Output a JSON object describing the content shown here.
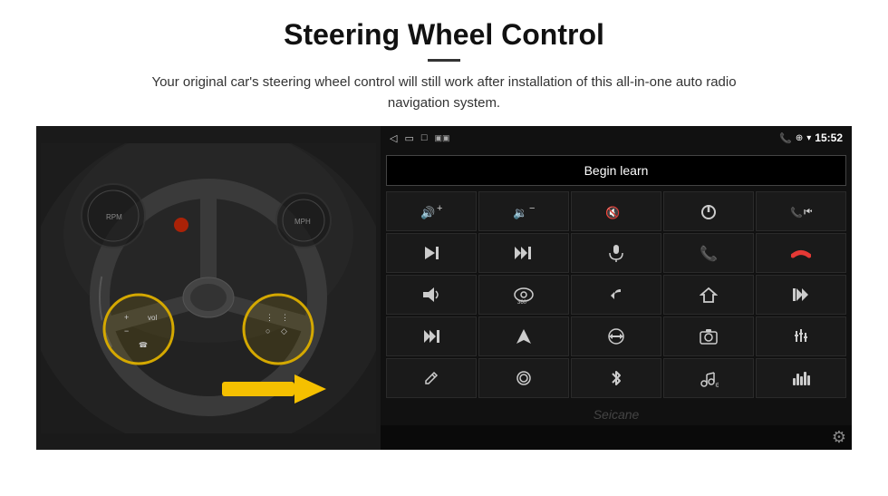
{
  "header": {
    "title": "Steering Wheel Control",
    "divider": true,
    "subtitle": "Your original car's steering wheel control will still work after installation of this all-in-one auto radio navigation system."
  },
  "statusbar": {
    "back_icon": "◁",
    "window_icon": "▭",
    "square_icon": "□",
    "signal_icon": "▣▣",
    "phone_icon": "📞",
    "location_icon": "⊕",
    "wifi_icon": "▾",
    "time": "15:52"
  },
  "begin_learn": {
    "label": "Begin learn"
  },
  "watermark": {
    "text": "Seicane"
  },
  "controls": [
    {
      "icon": "🔊+",
      "name": "vol-up"
    },
    {
      "icon": "🔊−",
      "name": "vol-down"
    },
    {
      "icon": "🔇",
      "name": "mute"
    },
    {
      "icon": "⏻",
      "name": "power"
    },
    {
      "icon": "⏮",
      "name": "prev-track-r"
    },
    {
      "icon": "⏭",
      "name": "next-track"
    },
    {
      "icon": "⤓⏭",
      "name": "skip-fwd"
    },
    {
      "icon": "🎤",
      "name": "mic"
    },
    {
      "icon": "📞",
      "name": "call"
    },
    {
      "icon": "↩",
      "name": "hang-up"
    },
    {
      "icon": "📢",
      "name": "horn"
    },
    {
      "icon": "👁360",
      "name": "360-view"
    },
    {
      "icon": "↺",
      "name": "back"
    },
    {
      "icon": "🏠",
      "name": "home"
    },
    {
      "icon": "⏮⏮",
      "name": "fast-back"
    },
    {
      "icon": "⏭⏭",
      "name": "fast-fwd"
    },
    {
      "icon": "▶",
      "name": "nav"
    },
    {
      "icon": "⇄",
      "name": "switch"
    },
    {
      "icon": "📷",
      "name": "camera"
    },
    {
      "icon": "⚙",
      "name": "eq"
    },
    {
      "icon": "✏",
      "name": "edit"
    },
    {
      "icon": "◎",
      "name": "record"
    },
    {
      "icon": "✱",
      "name": "bluetooth"
    },
    {
      "icon": "♫",
      "name": "music"
    },
    {
      "icon": "|||",
      "name": "spectrum"
    }
  ],
  "settings_icon": "⚙"
}
